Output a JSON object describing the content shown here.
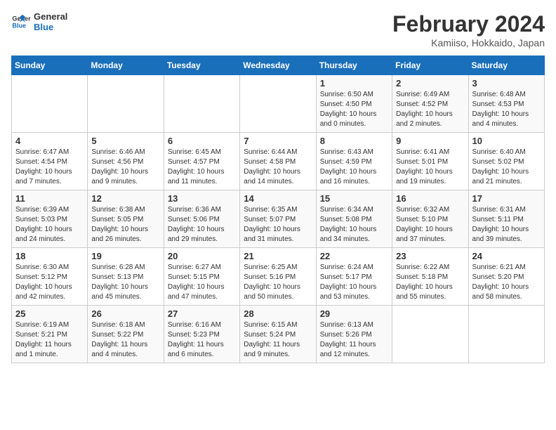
{
  "logo": {
    "line1": "General",
    "line2": "Blue"
  },
  "title": "February 2024",
  "subtitle": "Kamiiso, Hokkaido, Japan",
  "weekdays": [
    "Sunday",
    "Monday",
    "Tuesday",
    "Wednesday",
    "Thursday",
    "Friday",
    "Saturday"
  ],
  "weeks": [
    [
      {
        "day": "",
        "info": ""
      },
      {
        "day": "",
        "info": ""
      },
      {
        "day": "",
        "info": ""
      },
      {
        "day": "",
        "info": ""
      },
      {
        "day": "1",
        "info": "Sunrise: 6:50 AM\nSunset: 4:50 PM\nDaylight: 10 hours\nand 0 minutes."
      },
      {
        "day": "2",
        "info": "Sunrise: 6:49 AM\nSunset: 4:52 PM\nDaylight: 10 hours\nand 2 minutes."
      },
      {
        "day": "3",
        "info": "Sunrise: 6:48 AM\nSunset: 4:53 PM\nDaylight: 10 hours\nand 4 minutes."
      }
    ],
    [
      {
        "day": "4",
        "info": "Sunrise: 6:47 AM\nSunset: 4:54 PM\nDaylight: 10 hours\nand 7 minutes."
      },
      {
        "day": "5",
        "info": "Sunrise: 6:46 AM\nSunset: 4:56 PM\nDaylight: 10 hours\nand 9 minutes."
      },
      {
        "day": "6",
        "info": "Sunrise: 6:45 AM\nSunset: 4:57 PM\nDaylight: 10 hours\nand 11 minutes."
      },
      {
        "day": "7",
        "info": "Sunrise: 6:44 AM\nSunset: 4:58 PM\nDaylight: 10 hours\nand 14 minutes."
      },
      {
        "day": "8",
        "info": "Sunrise: 6:43 AM\nSunset: 4:59 PM\nDaylight: 10 hours\nand 16 minutes."
      },
      {
        "day": "9",
        "info": "Sunrise: 6:41 AM\nSunset: 5:01 PM\nDaylight: 10 hours\nand 19 minutes."
      },
      {
        "day": "10",
        "info": "Sunrise: 6:40 AM\nSunset: 5:02 PM\nDaylight: 10 hours\nand 21 minutes."
      }
    ],
    [
      {
        "day": "11",
        "info": "Sunrise: 6:39 AM\nSunset: 5:03 PM\nDaylight: 10 hours\nand 24 minutes."
      },
      {
        "day": "12",
        "info": "Sunrise: 6:38 AM\nSunset: 5:05 PM\nDaylight: 10 hours\nand 26 minutes."
      },
      {
        "day": "13",
        "info": "Sunrise: 6:36 AM\nSunset: 5:06 PM\nDaylight: 10 hours\nand 29 minutes."
      },
      {
        "day": "14",
        "info": "Sunrise: 6:35 AM\nSunset: 5:07 PM\nDaylight: 10 hours\nand 31 minutes."
      },
      {
        "day": "15",
        "info": "Sunrise: 6:34 AM\nSunset: 5:08 PM\nDaylight: 10 hours\nand 34 minutes."
      },
      {
        "day": "16",
        "info": "Sunrise: 6:32 AM\nSunset: 5:10 PM\nDaylight: 10 hours\nand 37 minutes."
      },
      {
        "day": "17",
        "info": "Sunrise: 6:31 AM\nSunset: 5:11 PM\nDaylight: 10 hours\nand 39 minutes."
      }
    ],
    [
      {
        "day": "18",
        "info": "Sunrise: 6:30 AM\nSunset: 5:12 PM\nDaylight: 10 hours\nand 42 minutes."
      },
      {
        "day": "19",
        "info": "Sunrise: 6:28 AM\nSunset: 5:13 PM\nDaylight: 10 hours\nand 45 minutes."
      },
      {
        "day": "20",
        "info": "Sunrise: 6:27 AM\nSunset: 5:15 PM\nDaylight: 10 hours\nand 47 minutes."
      },
      {
        "day": "21",
        "info": "Sunrise: 6:25 AM\nSunset: 5:16 PM\nDaylight: 10 hours\nand 50 minutes."
      },
      {
        "day": "22",
        "info": "Sunrise: 6:24 AM\nSunset: 5:17 PM\nDaylight: 10 hours\nand 53 minutes."
      },
      {
        "day": "23",
        "info": "Sunrise: 6:22 AM\nSunset: 5:18 PM\nDaylight: 10 hours\nand 55 minutes."
      },
      {
        "day": "24",
        "info": "Sunrise: 6:21 AM\nSunset: 5:20 PM\nDaylight: 10 hours\nand 58 minutes."
      }
    ],
    [
      {
        "day": "25",
        "info": "Sunrise: 6:19 AM\nSunset: 5:21 PM\nDaylight: 11 hours\nand 1 minute."
      },
      {
        "day": "26",
        "info": "Sunrise: 6:18 AM\nSunset: 5:22 PM\nDaylight: 11 hours\nand 4 minutes."
      },
      {
        "day": "27",
        "info": "Sunrise: 6:16 AM\nSunset: 5:23 PM\nDaylight: 11 hours\nand 6 minutes."
      },
      {
        "day": "28",
        "info": "Sunrise: 6:15 AM\nSunset: 5:24 PM\nDaylight: 11 hours\nand 9 minutes."
      },
      {
        "day": "29",
        "info": "Sunrise: 6:13 AM\nSunset: 5:26 PM\nDaylight: 11 hours\nand 12 minutes."
      },
      {
        "day": "",
        "info": ""
      },
      {
        "day": "",
        "info": ""
      }
    ]
  ]
}
